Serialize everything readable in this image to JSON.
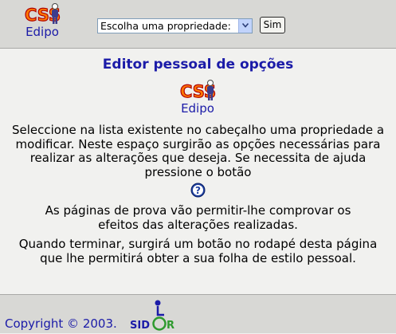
{
  "header": {
    "logo_caption": "Edipo",
    "property_select": {
      "selected": "Escolha uma propriedade:"
    },
    "submit_label": "Sim"
  },
  "main": {
    "title": "Editor pessoal de opções",
    "logo_caption": "Edipo",
    "intro": "Seleccione na lista existente no cabeçalho uma propriedade a modificar. Neste espaço surgirão as opções necessárias para realizar as alterações que deseja. Se necessita de ajuda pressione o botão",
    "preview_info": "As páginas de prova vão permitir-lhe comprovar os efeitos das alterações realizadas.",
    "finish_info": "Quando terminar, surgirá um botão no rodapé desta página que lhe permitirá obter a sua folha de estilo pessoal."
  },
  "footer": {
    "copyright": "Copyright © 2003.",
    "sidar_logo_text": "SIDAR"
  },
  "colors": {
    "link_blue": "#1b1ba8",
    "bar_gray": "#d8d8d5",
    "page_bg": "#f1f1ef"
  }
}
